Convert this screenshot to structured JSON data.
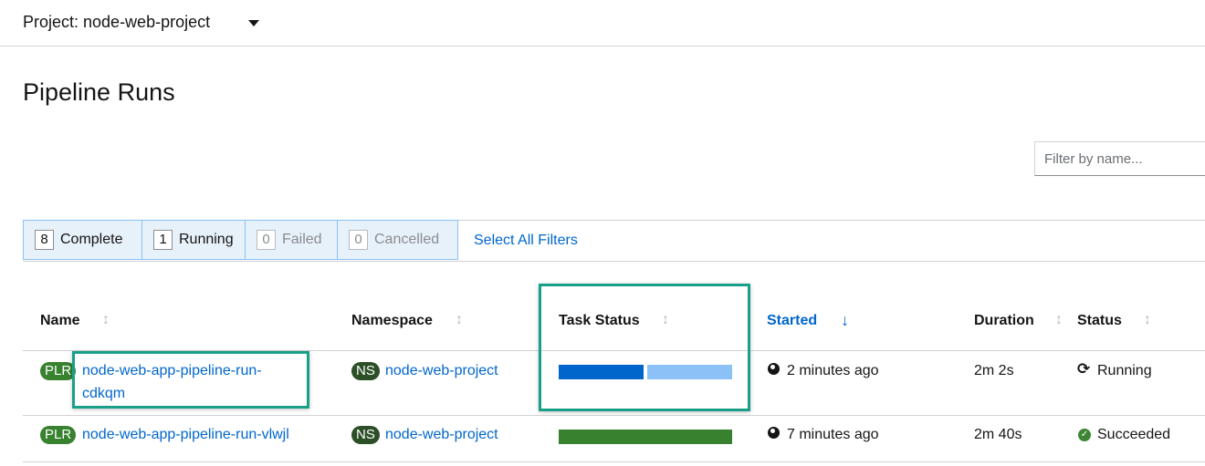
{
  "project": {
    "label": "Project: node-web-project"
  },
  "page": {
    "title": "Pipeline Runs"
  },
  "filter": {
    "placeholder": "Filter by name..."
  },
  "status_filters": [
    {
      "count": "8",
      "label": "Complete"
    },
    {
      "count": "1",
      "label": "Running"
    },
    {
      "count": "0",
      "label": "Failed"
    },
    {
      "count": "0",
      "label": "Cancelled"
    }
  ],
  "select_all_label": "Select All Filters",
  "columns": {
    "name": "Name",
    "namespace": "Namespace",
    "task_status": "Task Status",
    "started": "Started",
    "duration": "Duration",
    "status": "Status"
  },
  "rows": [
    {
      "badge": "PLR",
      "name_line1": "node-web-app-pipeline-run-",
      "name_line2": "cdkqm",
      "ns_badge": "NS",
      "namespace": "node-web-project",
      "started": "2 minutes ago",
      "duration": "2m 2s",
      "status": "Running",
      "task_progress": {
        "completed": 0.5,
        "pending": 0.5
      }
    },
    {
      "badge": "PLR",
      "name": "node-web-app-pipeline-run-vlwjl",
      "ns_badge": "NS",
      "namespace": "node-web-project",
      "started": "7 minutes ago",
      "duration": "2m 40s",
      "status": "Succeeded",
      "task_progress": {
        "succeeded": 1.0
      }
    }
  ],
  "colors": {
    "link": "#0066cc",
    "plr_badge": "#38812f",
    "ns_badge": "#2d4f28",
    "bar_running": "#0066cc",
    "bar_pending": "#8bc1f7",
    "bar_succeeded": "#38812f",
    "highlight": "#1aa089"
  }
}
